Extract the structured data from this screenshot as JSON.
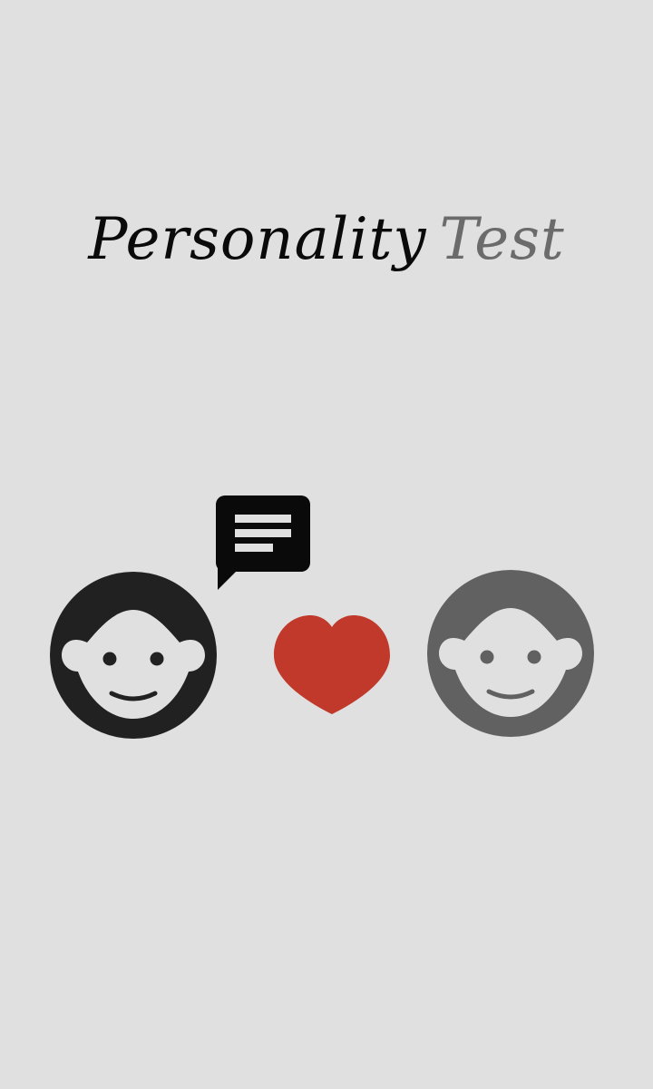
{
  "splash": {
    "title_primary": "Personality",
    "title_secondary": "Test"
  },
  "colors": {
    "background": "#e0e0e0",
    "title_primary": "#0a0a0a",
    "title_secondary": "#6b6b6b",
    "person_left": "#212121",
    "person_right": "#616161",
    "face": "#e0e0e0",
    "heart": "#c0392b",
    "chat_bubble": "#0a0a0a"
  },
  "icons": {
    "person_left": "face-icon",
    "person_right": "face-icon",
    "heart": "heart-icon",
    "chat": "chat-bubble-icon"
  }
}
